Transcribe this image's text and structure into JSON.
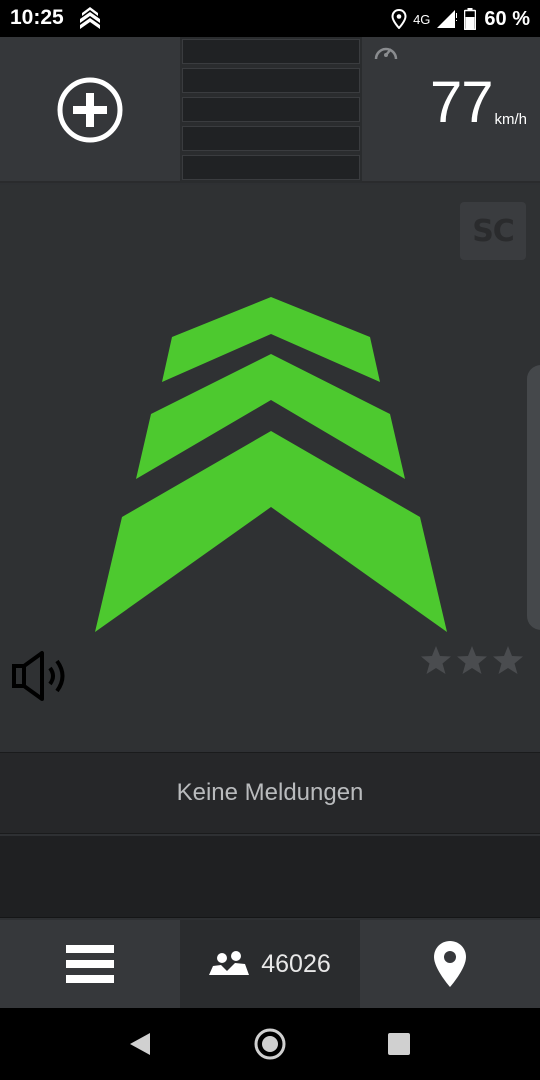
{
  "status_bar": {
    "time": "10:25",
    "network": "4G",
    "battery": "60 %",
    "icons": [
      "app-chevron-icon",
      "location-pin-icon",
      "signal-icon",
      "battery-icon"
    ]
  },
  "top_panel": {
    "add_icon": "plus-circle-icon",
    "signal_meter_segments": 5,
    "speedometer_icon": "speedometer-icon",
    "speed": "77",
    "speed_unit": "km/h"
  },
  "main": {
    "sc_label": "SC",
    "logo_icon": "green-chevron-logo",
    "logo_color": "#4dc92f",
    "speaker_icon": "speaker-icon",
    "rating_stars": 3,
    "star_icon": "star-icon"
  },
  "message_bar": {
    "text": "Keine Meldungen"
  },
  "bottom_toolbar": {
    "menu_icon": "hamburger-menu-icon",
    "users_icon": "users-icon",
    "users_count": "46026",
    "location_icon": "location-pin-icon"
  },
  "colors": {
    "accent": "#4dc92f",
    "background": "#2f3133",
    "panel": "#35373a"
  }
}
